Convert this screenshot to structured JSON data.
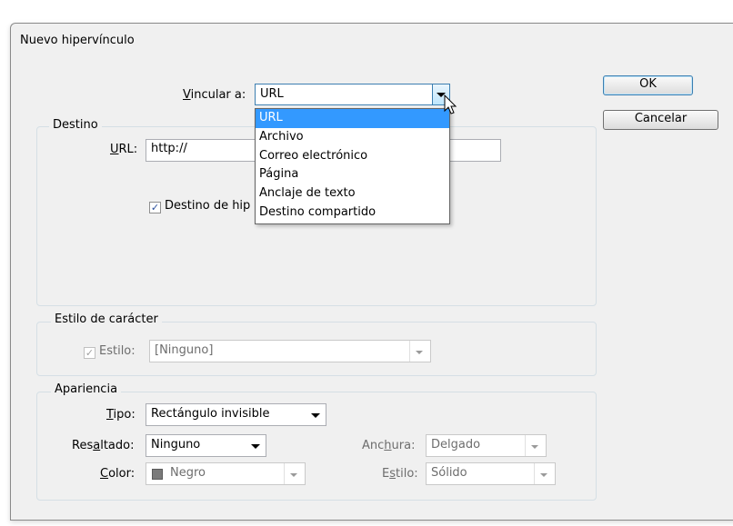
{
  "dialog": {
    "title": "Nuevo hipervínculo",
    "ok_label": "OK",
    "cancel_label": "Cancelar"
  },
  "link_to": {
    "label_underlined": "V",
    "label_rest": "incular a:",
    "value": "URL",
    "options": [
      "URL",
      "Archivo",
      "Correo electrónico",
      "Página",
      "Anclaje de texto",
      "Destino compartido"
    ],
    "selected_index": 0
  },
  "destino": {
    "group_label": "Destino",
    "url_label_underlined": "U",
    "url_label_rest": "RL:",
    "url_value": "http://",
    "checkbox_label": "Destino de hip",
    "checkbox_checked": true
  },
  "estilo_caracter": {
    "group_label": "Estilo de carácter",
    "checkbox_label": "Estilo:",
    "checkbox_checked": true,
    "value": "[Ninguno]"
  },
  "apariencia": {
    "group_label": "Apariencia",
    "tipo_label_underlined": "T",
    "tipo_label_rest": "ipo:",
    "tipo_value": "Rectángulo invisible",
    "resaltado_label_pre": "Res",
    "resaltado_label_underlined": "a",
    "resaltado_label_post": "ltado:",
    "resaltado_value": "Ninguno",
    "color_label_underlined": "C",
    "color_label_rest": "olor:",
    "color_value": "Negro",
    "color_swatch": "#7a7a7a",
    "anchura_label_pre": "Anc",
    "anchura_label_underlined": "h",
    "anchura_label_post": "ura:",
    "anchura_value": "Delgado",
    "estilo_label_pre": "E",
    "estilo_label_underlined": "s",
    "estilo_label_post": "tilo:",
    "estilo_value": "Sólido"
  },
  "colors": {
    "selection": "#3399ff",
    "dialog_bg": "#f0f0f0"
  }
}
